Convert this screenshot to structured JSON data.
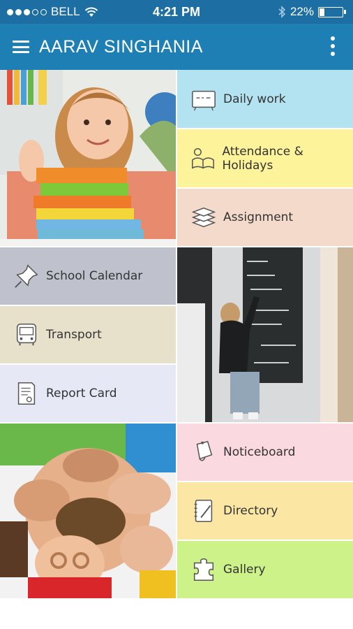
{
  "status_bar": {
    "carrier": "BELL",
    "time": "4:21 PM",
    "battery": "22%",
    "battery_level": 0.22,
    "signal_bars_filled": 3,
    "signal_bars_total": 5
  },
  "app_bar": {
    "title": "AARAV SINGHANIA",
    "menu_icon": "hamburger-icon",
    "more_icon": "more-vertical-icon"
  },
  "tiles": {
    "daily_work": {
      "label": "Daily work",
      "icon": "whiteboard-icon",
      "color": "#b3e3f0"
    },
    "attendance": {
      "label": "Attendance & Holidays",
      "icon": "reading-book-icon",
      "color": "#fdf39a"
    },
    "assignment": {
      "label": "Assignment",
      "icon": "books-stack-icon",
      "color": "#f3dacb"
    },
    "school_calendar": {
      "label": "School Calendar",
      "icon": "pushpin-icon",
      "color": "#bfc2cc"
    },
    "transport": {
      "label": "Transport",
      "icon": "bus-icon",
      "color": "#e7e1cc"
    },
    "report_card": {
      "label": "Report Card",
      "icon": "certificate-icon",
      "color": "#e6e9f5"
    },
    "noticeboard": {
      "label": "Noticeboard",
      "icon": "bell-icon",
      "color": "#fbd9e0"
    },
    "directory": {
      "label": "Directory",
      "icon": "notebook-icon",
      "color": "#fbe6a3"
    },
    "gallery": {
      "label": "Gallery",
      "icon": "puzzle-icon",
      "color": "#cdf28a"
    }
  },
  "photos": {
    "girl_books": "girl-with-books-photo",
    "boy_chalkboard": "boy-at-chalkboard-photo",
    "kids_circle": "kids-circle-photo"
  }
}
